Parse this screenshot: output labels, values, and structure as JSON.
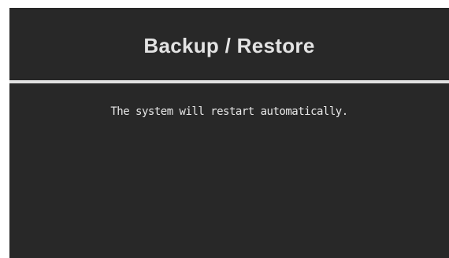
{
  "dialog": {
    "title": "Backup / Restore",
    "message": "The system will restart automatically."
  },
  "colors": {
    "background": "#282828",
    "text": "#e3e3e3",
    "divider": "#e2e2e2"
  }
}
